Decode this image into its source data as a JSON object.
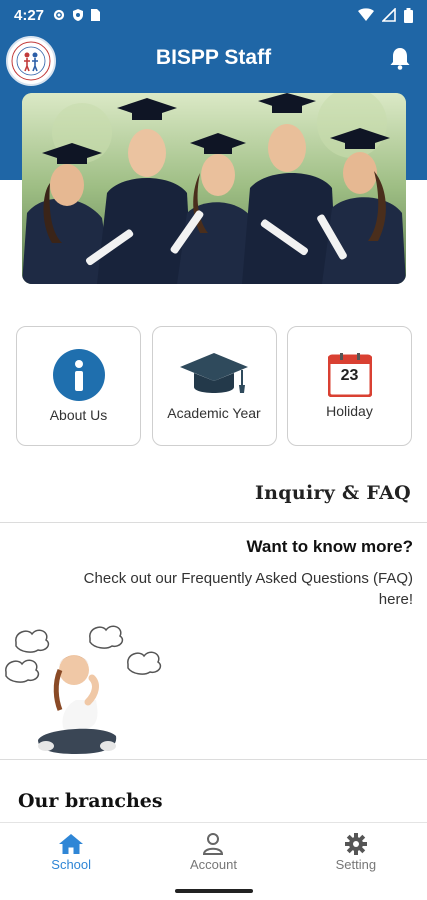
{
  "status_bar": {
    "time": "4:27"
  },
  "header": {
    "title": "BISPP Staff",
    "logo_icon": "school-logo-icon",
    "bell_icon": "bell-icon"
  },
  "tiles": [
    {
      "label": "About Us",
      "icon": "info-icon"
    },
    {
      "label": "Academic Year",
      "icon": "graduation-cap-icon"
    },
    {
      "label": "Holiday",
      "icon": "calendar-icon",
      "calendar_day": "23"
    }
  ],
  "inquiry": {
    "title": "Inquiry & FAQ",
    "question": "Want to know more?",
    "description": "Check out our Frequently Asked Questions (FAQ) here!"
  },
  "branches": {
    "title": "Our branches"
  },
  "bottom_nav": [
    {
      "label": "School",
      "icon": "home-icon",
      "active": true
    },
    {
      "label": "Account",
      "icon": "user-icon",
      "active": false
    },
    {
      "label": "Setting",
      "icon": "gear-icon",
      "active": false
    }
  ],
  "colors": {
    "primary": "#1f66a6",
    "accent": "#2f86d6",
    "info_circle": "#1f6fae",
    "calendar_red": "#d94032"
  }
}
